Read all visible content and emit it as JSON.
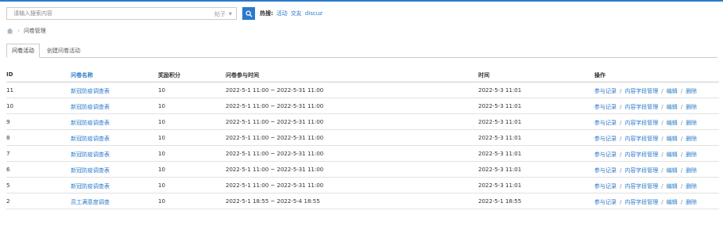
{
  "search": {
    "placeholder": "请输入搜索内容",
    "type": "帖子",
    "hot_label": "热搜:",
    "hot_links": [
      "活动",
      "交友",
      "discuz"
    ]
  },
  "breadcrumb": {
    "current": "问卷管理"
  },
  "tabs": [
    "问卷活动",
    "创建问卷活动"
  ],
  "table": {
    "headers": {
      "id": "ID",
      "name": "问卷名称",
      "points": "奖励积分",
      "time": "问卷参与时间",
      "date": "时间",
      "ops": "操作"
    },
    "actions": [
      "参与记录",
      "内容字段管理",
      "编辑",
      "删除"
    ],
    "rows": [
      {
        "id": "11",
        "name": "新冠防疫调查表",
        "points": "10",
        "time": "2022-5-1 11:00 ~ 2022-5-31 11:00",
        "date": "2022-5-3 11:01"
      },
      {
        "id": "10",
        "name": "新冠防疫调查表",
        "points": "10",
        "time": "2022-5-1 11:00 ~ 2022-5-31 11:00",
        "date": "2022-5-3 11:01"
      },
      {
        "id": "9",
        "name": "新冠防疫调查表",
        "points": "10",
        "time": "2022-5-1 11:00 ~ 2022-5-31 11:00",
        "date": "2022-5-3 11:01"
      },
      {
        "id": "8",
        "name": "新冠防疫调查表",
        "points": "10",
        "time": "2022-5-1 11:00 ~ 2022-5-31 11:00",
        "date": "2022-5-3 11:01"
      },
      {
        "id": "7",
        "name": "新冠防疫调查表",
        "points": "10",
        "time": "2022-5-1 11:00 ~ 2022-5-31 11:00",
        "date": "2022-5-3 11:01"
      },
      {
        "id": "6",
        "name": "新冠防疫调查表",
        "points": "10",
        "time": "2022-5-1 11:00 ~ 2022-5-31 11:00",
        "date": "2022-5-3 11:01"
      },
      {
        "id": "5",
        "name": "新冠防疫调查表",
        "points": "10",
        "time": "2022-5-1 11:00 ~ 2022-5-31 11:00",
        "date": "2022-5-3 11:01"
      },
      {
        "id": "2",
        "name": "员工满意度调查",
        "points": "10",
        "time": "2022-5-1 18:55 ~ 2022-5-4 18:55",
        "date": "2022-5-1 18:55"
      }
    ]
  },
  "colors": {
    "accent": "#2b7acb"
  }
}
